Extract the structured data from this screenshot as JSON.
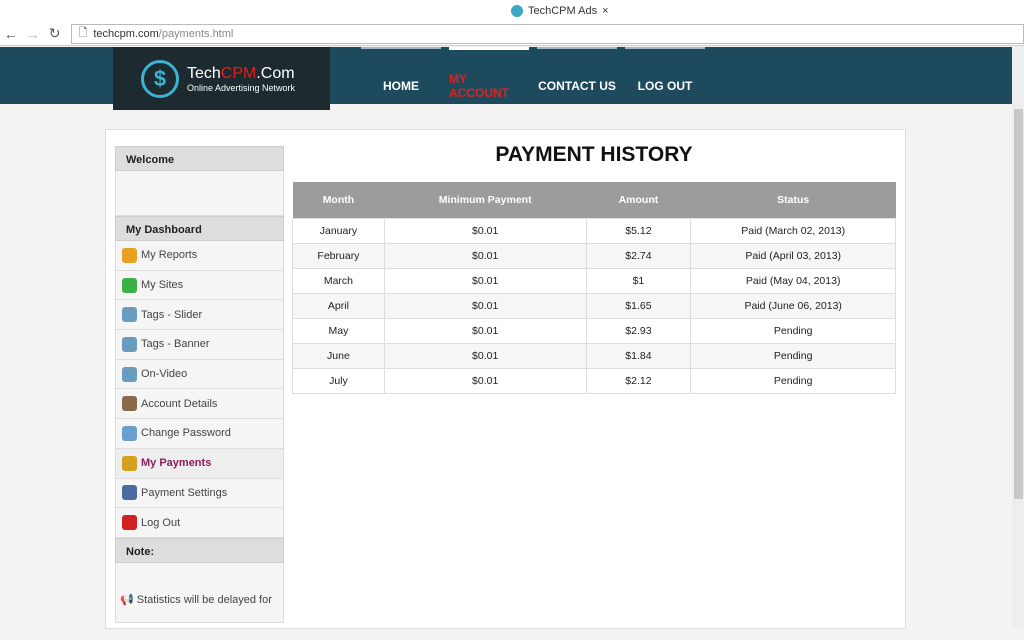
{
  "browser": {
    "tab_title": "TechCPM Ads",
    "url_host": "techcpm.com",
    "url_path": "/payments.html"
  },
  "header": {
    "logo_tech": "Tech",
    "logo_cpm": "CPM",
    "logo_com": ".Com",
    "tagline": "Online Advertising Network",
    "menu": [
      "HOME",
      "MY ACCOUNT",
      "CONTACT US",
      "LOG OUT"
    ]
  },
  "sidebar": {
    "welcome": "Welcome",
    "dashboard": "My Dashboard",
    "items": [
      {
        "label": "My Reports",
        "color": "#e9a020"
      },
      {
        "label": "My Sites",
        "color": "#3cb043"
      },
      {
        "label": "Tags - Slider",
        "color": "#6a9cc0"
      },
      {
        "label": "Tags - Banner",
        "color": "#6a9cc0"
      },
      {
        "label": "On-Video",
        "color": "#6a9cc0"
      },
      {
        "label": "Account Details",
        "color": "#8a6a4a"
      },
      {
        "label": "Change Password",
        "color": "#6aa0d0"
      },
      {
        "label": "My Payments",
        "color": "#d4a020"
      },
      {
        "label": "Payment Settings",
        "color": "#4a6aa0"
      },
      {
        "label": "Log Out",
        "color": "#d02020"
      }
    ],
    "note_title": "Note:",
    "note_text": "Statistics will be delayed for"
  },
  "main": {
    "title": "PAYMENT HISTORY",
    "columns": [
      "Month",
      "Minimum Payment",
      "Amount",
      "Status"
    ],
    "rows": [
      [
        "January",
        "$0.01",
        "$5.12",
        "Paid (March 02, 2013)"
      ],
      [
        "February",
        "$0.01",
        "$2.74",
        "Paid (April 03, 2013)"
      ],
      [
        "March",
        "$0.01",
        "$1",
        "Paid (May 04, 2013)"
      ],
      [
        "April",
        "$0.01",
        "$1.65",
        "Paid (June 06, 2013)"
      ],
      [
        "May",
        "$0.01",
        "$2.93",
        "Pending"
      ],
      [
        "June",
        "$0.01",
        "$1.84",
        "Pending"
      ],
      [
        "July",
        "$0.01",
        "$2.12",
        "Pending"
      ]
    ]
  }
}
